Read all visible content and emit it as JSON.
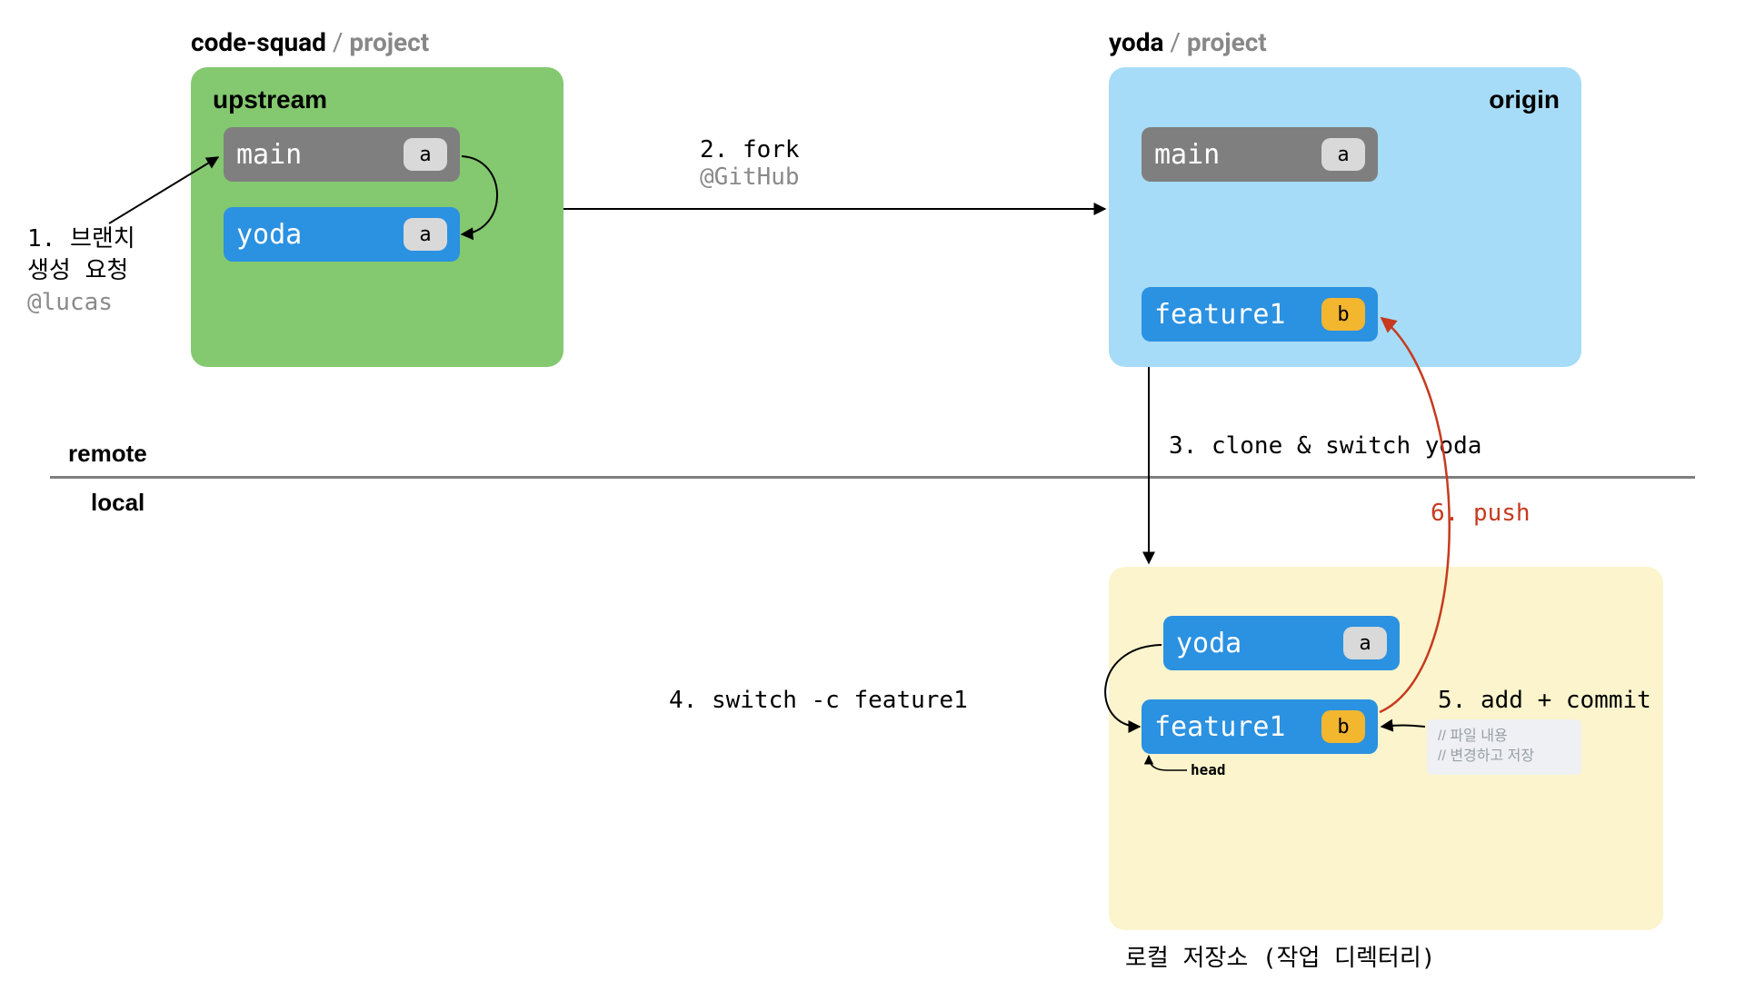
{
  "upstream": {
    "owner": "code-squad",
    "sep": " / ",
    "proj": "project",
    "panel_label": "upstream",
    "branches": [
      {
        "name": "main",
        "badge": "a",
        "badge_color": "gray",
        "color": "gray"
      },
      {
        "name": "yoda",
        "badge": "a",
        "badge_color": "gray",
        "color": "blue"
      }
    ]
  },
  "origin": {
    "owner": "yoda",
    "sep": " / ",
    "proj": "project",
    "panel_label": "origin",
    "branches": [
      {
        "name": "main",
        "badge": "a",
        "badge_color": "gray",
        "color": "gray"
      },
      {
        "name": "feature1",
        "badge": "b",
        "badge_color": "yellow",
        "color": "blue"
      }
    ]
  },
  "local": {
    "panel_label": "",
    "branches": [
      {
        "name": "yoda",
        "badge": "a",
        "badge_color": "gray",
        "color": "blue"
      },
      {
        "name": "feature1",
        "badge": "b",
        "badge_color": "yellow",
        "color": "blue"
      }
    ],
    "head_label": "head",
    "footer": "로컬 저장소 (작업 디렉터리)"
  },
  "zones": {
    "remote": "remote",
    "local": "local"
  },
  "steps": {
    "s1_line1": "1. 브랜치",
    "s1_line2": "생성 요청",
    "s1_at": "@lucas",
    "s2": "2. fork",
    "s2_at": "@GitHub",
    "s3": "3. clone & switch yoda",
    "s4": "4. switch -c feature1",
    "s5": "5. add + commit",
    "s6": "6. push"
  },
  "file_note": {
    "line1": "// 파일 내용",
    "line2": "// 변경하고 저장"
  },
  "colors": {
    "green": "#84c870",
    "blue_panel": "#a6dcf7",
    "yellow_panel": "#fbf4cc",
    "branch_blue": "#2b91e1",
    "branch_gray": "#7f7f7f",
    "badge_yellow": "#f3b62f",
    "red": "#c63a1f"
  }
}
